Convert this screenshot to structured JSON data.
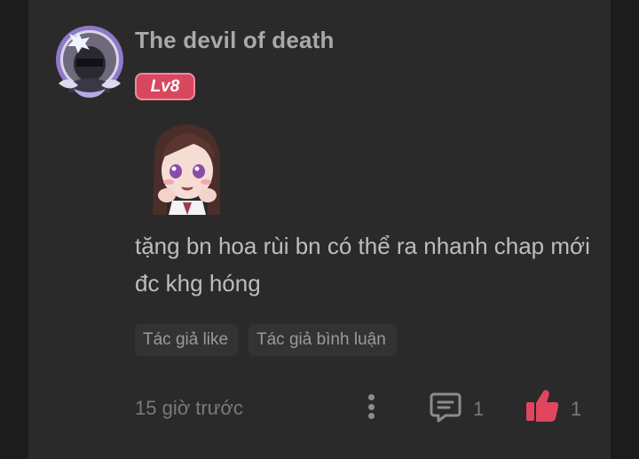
{
  "comment": {
    "username": "The devil of death",
    "level": "Lv8",
    "text": "tặng bn hoa rùi bn có thể ra nhanh chap mới đc khg hóng",
    "tags": [
      "Tác giả like",
      "Tác giả bình luận"
    ],
    "timestamp": "15 giờ trước",
    "reply_count": "1",
    "like_count": "1"
  },
  "icons": {
    "more": "more-vertical-icon",
    "reply": "comment-icon",
    "like": "thumbs-up-icon"
  },
  "colors": {
    "background": "#2a2a2a",
    "badge": "#d9475f",
    "like": "#e0465e"
  }
}
